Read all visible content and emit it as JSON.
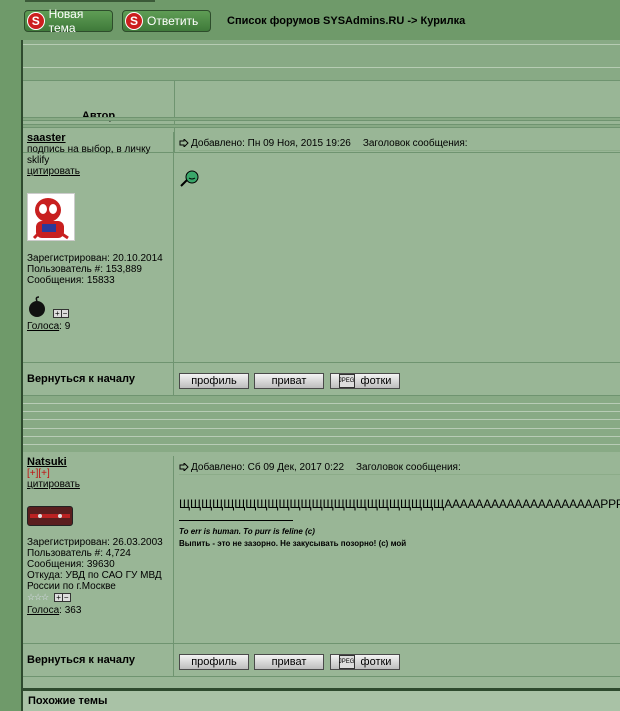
{
  "nav": {
    "new_topic": "Новая тема",
    "reply": "Ответить",
    "breadcrumb": "Список форумов SYSAdmins.RU -> Курилка"
  },
  "table": {
    "author_header": "Автор"
  },
  "posts": [
    {
      "username": "saaster",
      "signature_lines": [
        "подпись на выбор, в личку",
        "sklify"
      ],
      "quote_link": "цитировать",
      "registered": "Зарегистрирован: 20.10.2014",
      "user_number": "Пользователь #: 153,889",
      "messages": "Сообщения: 15833",
      "votes_label": "Голоса",
      "votes_value": ": 9",
      "posted": "Добавлено: Пн 09 Ноя, 2015 19:26",
      "subject_label": "Заголовок сообщения:",
      "back_to_top": "Вернуться к началу"
    },
    {
      "username": "Natsuki",
      "badges": "[+][+]",
      "quote_link": "цитировать",
      "registered": "Зарегистрирован: 26.03.2003",
      "user_number": "Пользователь #: 4,724",
      "messages": "Сообщения: 39630",
      "location": "Откуда: УВД по САО ГУ МВД России по г.Москве",
      "votes_label": "Голоса",
      "votes_value": ": 363",
      "posted": "Добавлено: Сб 09 Дек, 2017 0:22",
      "subject_label": "Заголовок сообщения:",
      "body": "ЩЩЩЩЩЩЩЩЩЩЩЩЩЩЩЩЩЩЩЩЩЩЩЩААААААААААААААААААААРРРРРРРРРРРРРРРР",
      "sig1": "To err is human. To purr is feline (c)",
      "sig2": "Выпить - это не зазорно. Не закусывать позорно! (c) мой",
      "back_to_top": "Вернуться к началу"
    }
  ],
  "buttons": {
    "profile": "профиль",
    "pm": "приват",
    "photos": "фотки",
    "photos_icon_text": "JPEG"
  },
  "similar_topics": "Похожие темы",
  "colors": {
    "bg": "#6f9a6a",
    "panel": "#99b696",
    "nav_button": "#4f8c47",
    "s_badge": "#cc1e1e"
  }
}
